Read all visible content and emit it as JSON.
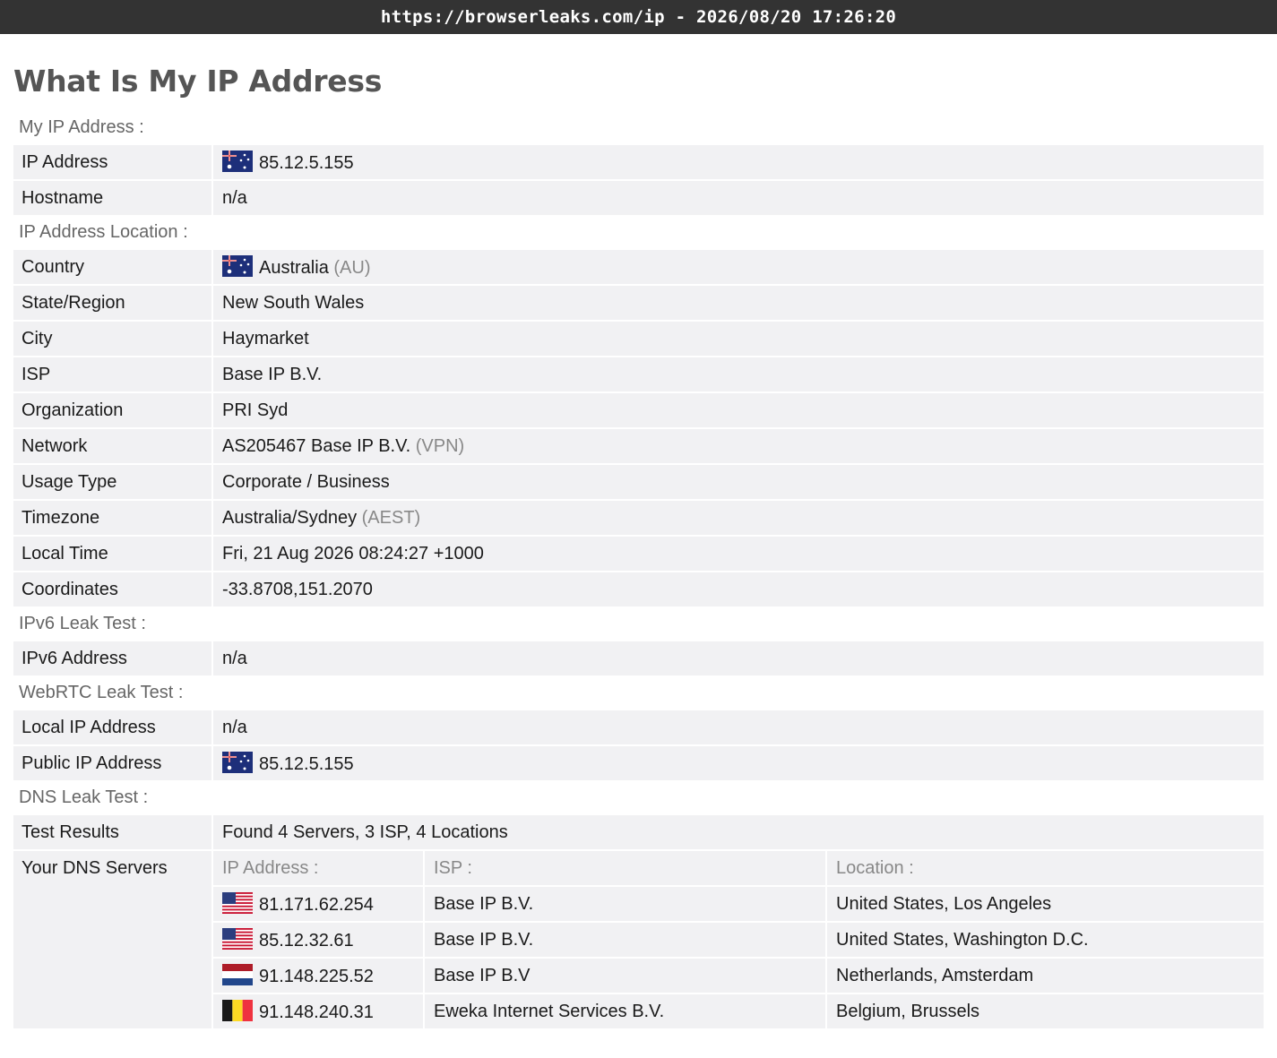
{
  "topbar": {
    "url_line": "https://browserleaks.com/ip - 2026/08/20 17:26:20"
  },
  "page_title": "What Is My IP Address",
  "sections": {
    "my_ip": {
      "title": "My IP Address :",
      "rows": [
        {
          "label": "IP Address",
          "value": "85.12.5.155",
          "flag": "au-flag-icon"
        },
        {
          "label": "Hostname",
          "value": "n/a"
        }
      ]
    },
    "location": {
      "title": "IP Address Location :",
      "rows": [
        {
          "label": "Country",
          "value": "Australia",
          "note": "(AU)",
          "flag": "au-flag-icon"
        },
        {
          "label": "State/Region",
          "value": "New South Wales"
        },
        {
          "label": "City",
          "value": "Haymarket"
        },
        {
          "label": "ISP",
          "value": "Base IP B.V."
        },
        {
          "label": "Organization",
          "value": "PRI Syd"
        },
        {
          "label": "Network",
          "value": "AS205467 Base IP B.V.",
          "note": "(VPN)"
        },
        {
          "label": "Usage Type",
          "value": "Corporate / Business"
        },
        {
          "label": "Timezone",
          "value": "Australia/Sydney",
          "note": "(AEST)"
        },
        {
          "label": "Local Time",
          "value": "Fri, 21 Aug 2026 08:24:27 +1000"
        },
        {
          "label": "Coordinates",
          "value": "-33.8708,151.2070"
        }
      ]
    },
    "ipv6": {
      "title": "IPv6 Leak Test :",
      "rows": [
        {
          "label": "IPv6 Address",
          "value": "n/a"
        }
      ]
    },
    "webrtc": {
      "title": "WebRTC Leak Test :",
      "rows": [
        {
          "label": "Local IP Address",
          "value": "n/a"
        },
        {
          "label": "Public IP Address",
          "value": "85.12.5.155",
          "flag": "au-flag-icon"
        }
      ]
    },
    "dns": {
      "title": "DNS Leak Test :",
      "test_results_label": "Test Results",
      "test_results_value": "Found 4 Servers, 3 ISP, 4 Locations",
      "servers_label": "Your DNS Servers",
      "columns": [
        "IP Address :",
        "ISP :",
        "Location :"
      ],
      "servers": [
        {
          "ip": "81.171.62.254",
          "isp": "Base IP B.V.",
          "location": "United States, Los Angeles",
          "flag": "us-flag-icon"
        },
        {
          "ip": "85.12.32.61",
          "isp": "Base IP B.V.",
          "location": "United States, Washington D.C.",
          "flag": "us-flag-icon"
        },
        {
          "ip": "91.148.225.52",
          "isp": "Base IP B.V",
          "location": "Netherlands, Amsterdam",
          "flag": "nl-flag-icon"
        },
        {
          "ip": "91.148.240.31",
          "isp": "Eweka Internet Services B.V.",
          "location": "Belgium, Brussels",
          "flag": "be-flag-icon"
        }
      ]
    }
  }
}
